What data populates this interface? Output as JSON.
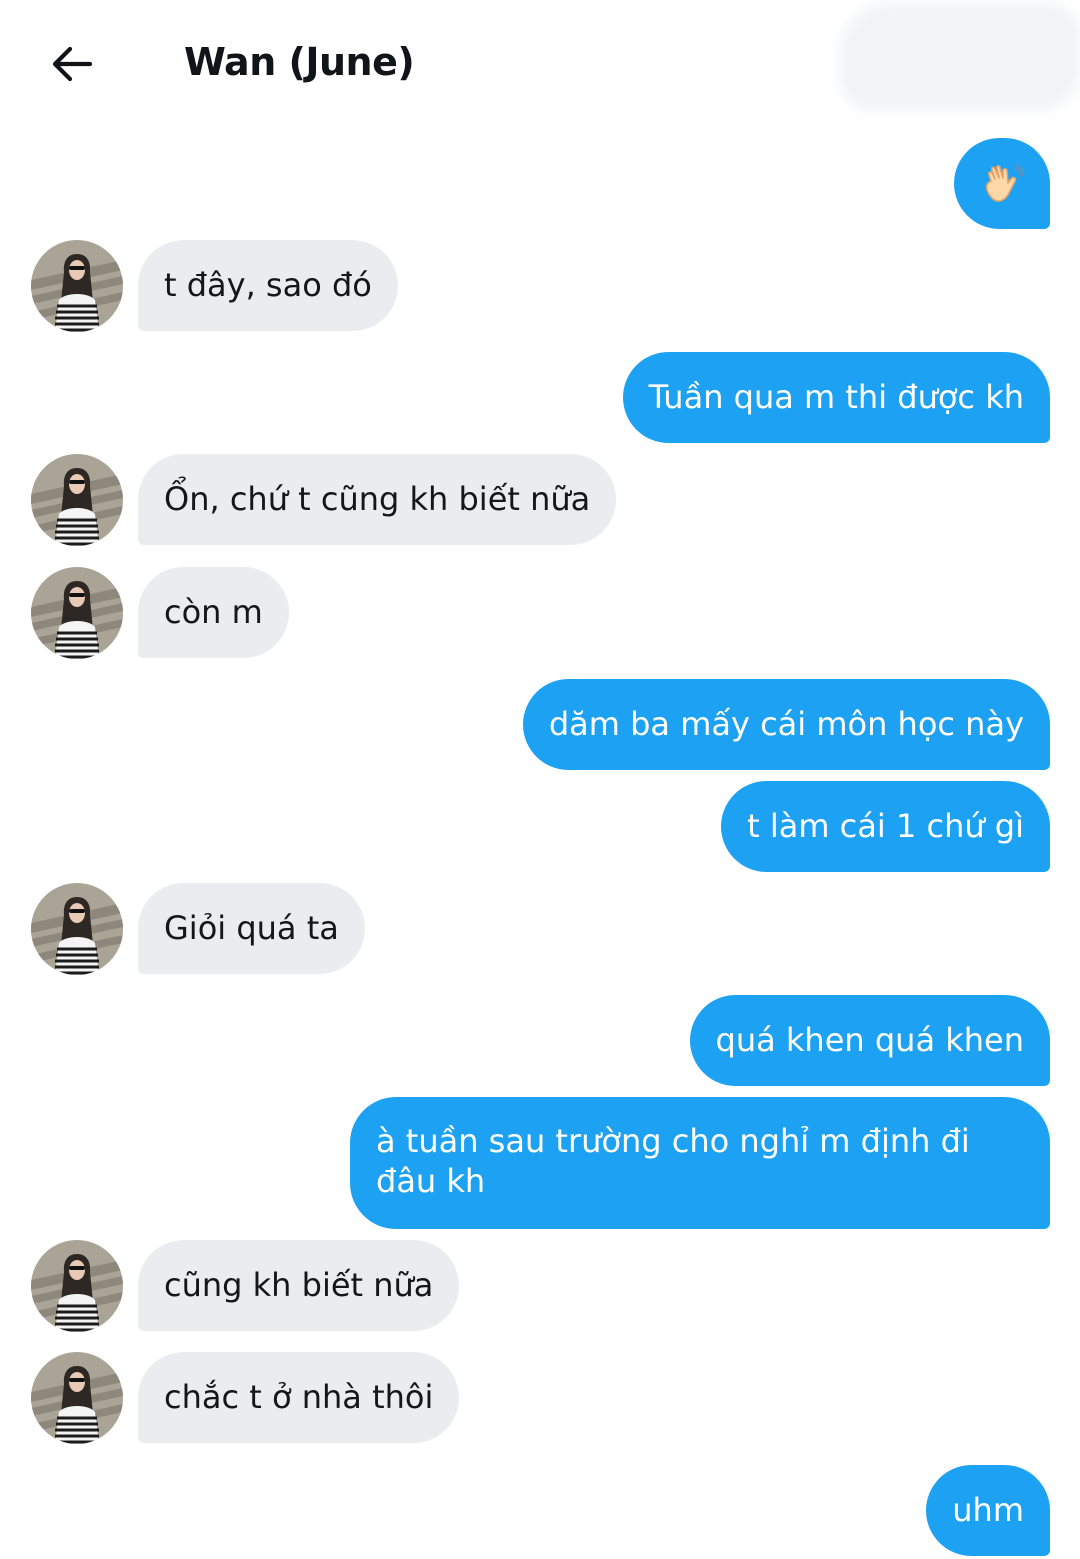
{
  "header": {
    "title": "Wan (June)",
    "back_icon": "arrow-left-icon"
  },
  "contact": {
    "avatar_icon": "contact-avatar"
  },
  "colors": {
    "outgoing": "#1da1f2",
    "incoming": "#e9edf0",
    "outgoing_text": "#ffffff",
    "incoming_text": "#14171a"
  },
  "messages": [
    {
      "from": "me",
      "emoji": "waving-hand"
    },
    {
      "from": "them",
      "text": "t đây, sao đó"
    },
    {
      "from": "me",
      "text": "Tuần qua m thi được kh"
    },
    {
      "from": "them",
      "text": "Ổn, chứ t cũng kh biết nữa"
    },
    {
      "from": "them",
      "text": "còn m"
    },
    {
      "from": "me",
      "text": "dăm ba mấy cái môn học này"
    },
    {
      "from": "me",
      "text": "t làm cái 1 chứ gì"
    },
    {
      "from": "them",
      "text": "Giỏi quá ta"
    },
    {
      "from": "me",
      "text": "quá khen quá khen"
    },
    {
      "from": "me",
      "text": "à tuần sau trường cho nghỉ m định đi đâu kh"
    },
    {
      "from": "them",
      "text": "cũng kh biết nữa"
    },
    {
      "from": "them",
      "text": "chắc t ở nhà thôi"
    },
    {
      "from": "me",
      "text": "uhm"
    }
  ]
}
